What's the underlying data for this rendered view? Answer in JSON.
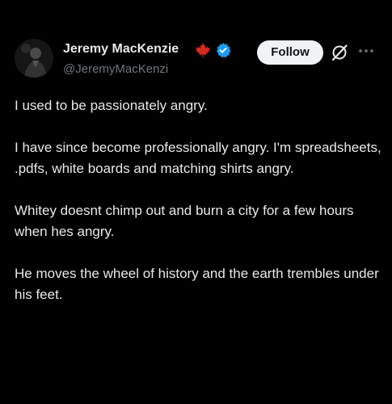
{
  "author": {
    "name": "Jeremy MacKenzie",
    "handle": "@JeremyMacKenzi",
    "flag": "maple-leaf-icon",
    "badge": "verified-badge-icon"
  },
  "actions": {
    "follow_label": "Follow",
    "grok_icon": "grok-icon",
    "more_icon": "more-options-icon"
  },
  "tweet": {
    "paragraphs": [
      "I used to be passionately angry.",
      "I have since become professionally angry. I'm spreadsheets, .pdfs, white boards and matching shirts angry.",
      "Whitey doesnt chimp out and burn a city for a few hours when hes angry.",
      "He moves the wheel of history and the earth trembles under his feet."
    ]
  },
  "colors": {
    "background": "#000000",
    "text": "#e7e9ea",
    "secondary_text": "#71767b",
    "verified": "#1d9bf0",
    "maple_leaf": "#d52b1e",
    "follow_bg": "#eff3f4"
  }
}
